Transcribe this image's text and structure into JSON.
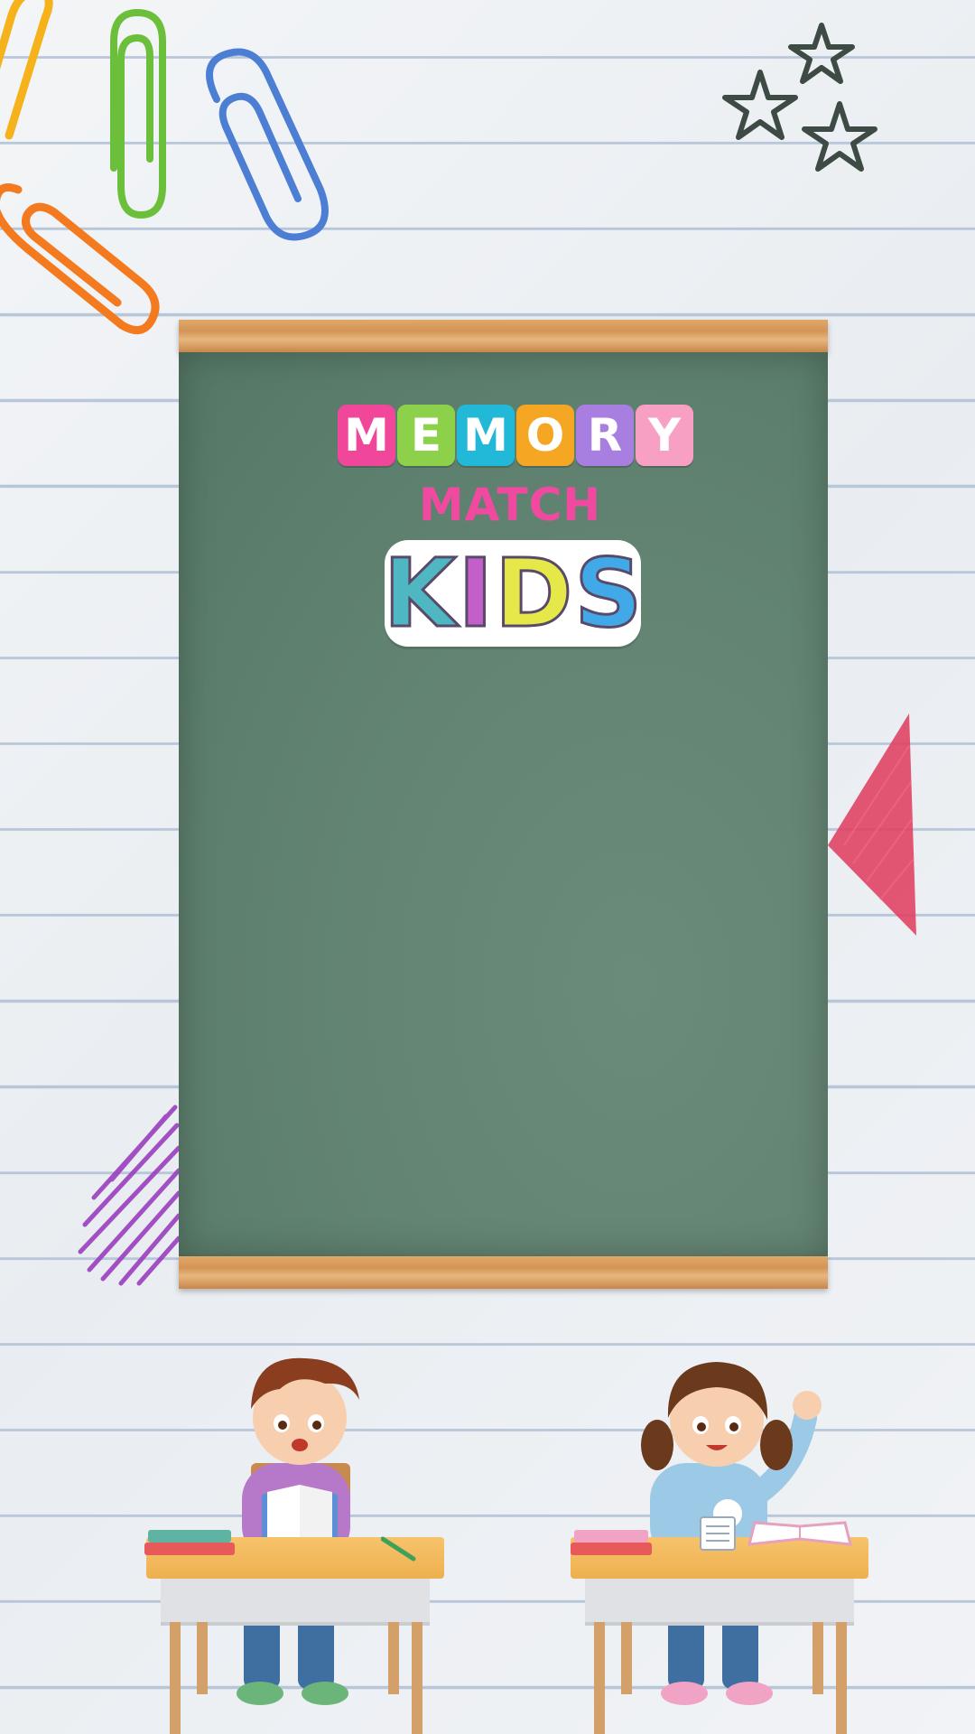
{
  "title": {
    "memory_letters": [
      {
        "char": "M",
        "color": "#f0479b"
      },
      {
        "char": "E",
        "color": "#8dd14a"
      },
      {
        "char": "M",
        "color": "#22b8d8"
      },
      {
        "char": "O",
        "color": "#f5a623"
      },
      {
        "char": "R",
        "color": "#a87fe0"
      },
      {
        "char": "Y",
        "color": "#f7a0c4"
      }
    ],
    "match": "MATCH",
    "kids_letters": [
      {
        "char": "K",
        "color": "#4fb7c2"
      },
      {
        "char": "I",
        "color": "#c25fc9"
      },
      {
        "char": "D",
        "color": "#e6e84a"
      },
      {
        "char": "S",
        "color": "#41a9e8"
      }
    ]
  },
  "colors": {
    "board": "#638472",
    "rail": "#d9a064",
    "paper": "#eef1f4",
    "paper_line": "#b8c6da"
  },
  "decorations": [
    "paperclip-yellow",
    "paperclip-green",
    "paperclip-blue",
    "paperclip-orange",
    "star-doodles",
    "red-crayon-triangle",
    "purple-crayon-scribble",
    "boy-reading-at-desk",
    "girl-raising-hand-at-desk"
  ]
}
